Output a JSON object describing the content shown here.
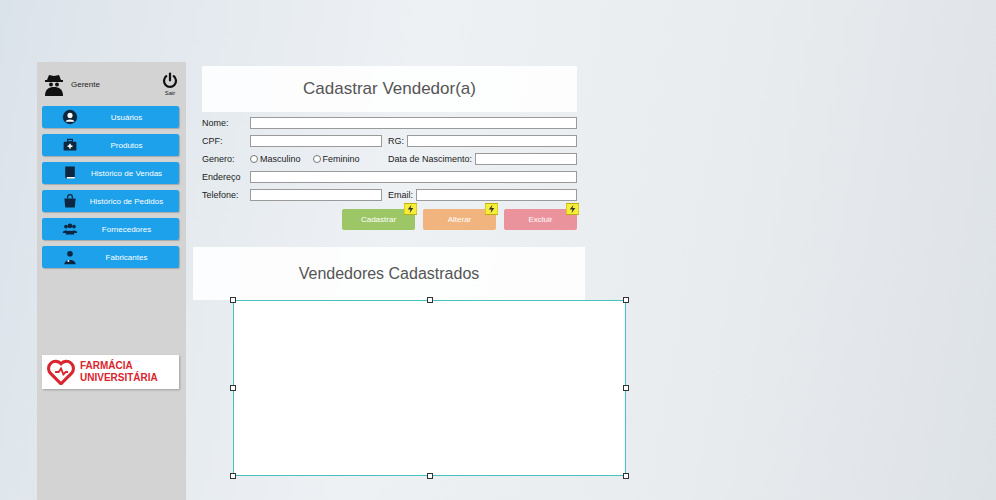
{
  "sidebar": {
    "user": {
      "role": "Gerente"
    },
    "logout": "Sair",
    "items": [
      {
        "label": "Usuários"
      },
      {
        "label": "Produtos"
      },
      {
        "label": "Histórico de Vendas"
      },
      {
        "label": "Histórico de Pedidos"
      },
      {
        "label": "Fornecedores"
      },
      {
        "label": "Fabricantes"
      }
    ],
    "logo": {
      "line1": "FARMÁCIA",
      "line2": "UNIVERSITÁRIA"
    }
  },
  "form": {
    "title": "Cadastrar Vendedor(a)",
    "rows": [
      [
        {
          "label": "Nome:",
          "kind": "text",
          "value": ""
        }
      ],
      [
        {
          "label": "CPF:",
          "kind": "text",
          "value": ""
        },
        {
          "label": "RG:",
          "kind": "text",
          "value": ""
        }
      ],
      [
        {
          "label": "Genero:",
          "kind": "radio",
          "options": [
            {
              "label": "Masculino",
              "selected": false
            },
            {
              "label": "Feminino",
              "selected": false
            }
          ]
        },
        {
          "label": "Data de Nascimento:",
          "kind": "text",
          "value": ""
        }
      ],
      [
        {
          "label": "Endereço",
          "kind": "text",
          "value": ""
        }
      ],
      [
        {
          "label": "Telefone:",
          "kind": "text",
          "value": ""
        },
        {
          "label": "Email:",
          "kind": "text",
          "value": ""
        }
      ]
    ],
    "buttons": [
      {
        "label": "Cadastrar",
        "color": "#9dc667"
      },
      {
        "label": "Alterar",
        "color": "#f1b47f"
      },
      {
        "label": "Excluir",
        "color": "#eb939c"
      }
    ]
  },
  "list": {
    "title": "Vendedores Cadastrados",
    "table": {
      "columns": [],
      "rows": [],
      "selected": true
    }
  }
}
